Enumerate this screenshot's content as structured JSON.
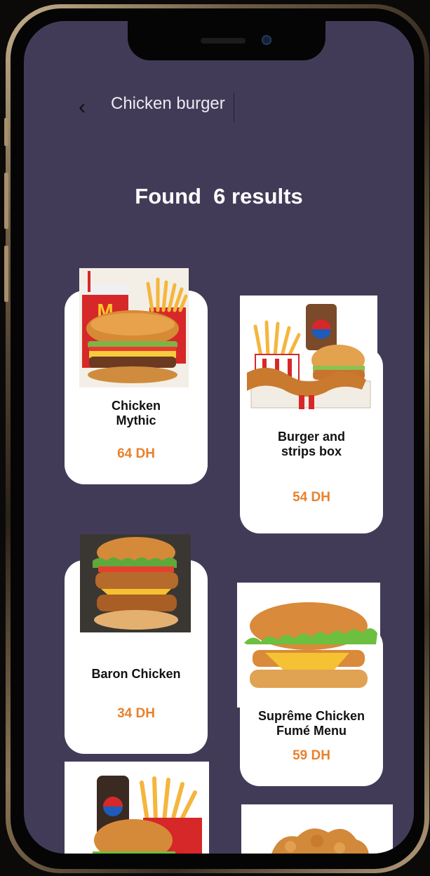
{
  "search": {
    "query": "Chicken burger"
  },
  "results_heading": "Found  6 results",
  "colors": {
    "screen_bg": "#423b58",
    "card_bg": "#ffffff",
    "price": "#e8812d"
  },
  "products": [
    {
      "name": "Chicken Mythic",
      "price": "64 DH",
      "image": "burger-fries-cola-meal-image"
    },
    {
      "name": "Burger and strips box",
      "price": "54 DH",
      "image": "burger-strips-box-image"
    },
    {
      "name": "Baron Chicken",
      "price": "34 DH",
      "image": "double-crispy-chicken-burger-image"
    },
    {
      "name": "Suprême Chicken Fumé Menu",
      "price": "59 DH",
      "image": "cheese-chicken-burger-image"
    },
    {
      "image": "burger-menu-with-pepsi-image"
    },
    {
      "image": "fried-chicken-strips-image"
    }
  ]
}
